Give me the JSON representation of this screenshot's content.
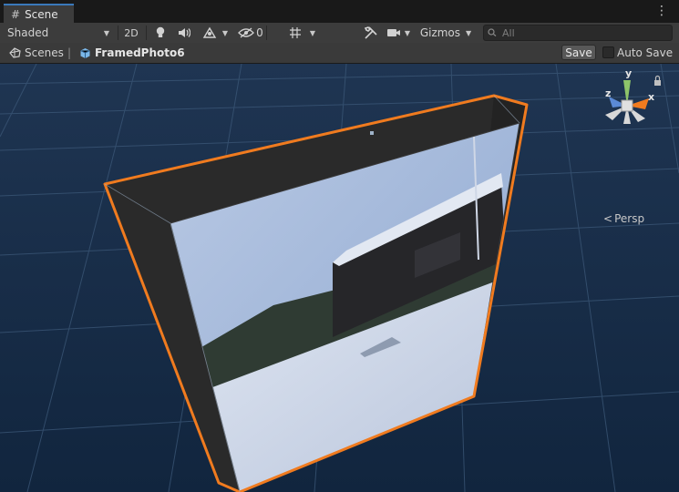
{
  "tab": {
    "icon": "grid-icon",
    "title": "Scene"
  },
  "toolbar": {
    "shading_mode": "Shaded",
    "mode_2d": "2D",
    "hidden_count": "0",
    "gizmos_label": "Gizmos",
    "search_placeholder": "All"
  },
  "breadcrumb": {
    "root": "Scenes",
    "separator": "|",
    "current": "FramedPhoto6"
  },
  "actions": {
    "save_label": "Save",
    "autosave_label": "Auto Save",
    "autosave_checked": false
  },
  "view_gizmo": {
    "y_label": "y",
    "x_label": "x",
    "z_label": "z",
    "projection_label": "Persp"
  },
  "colors": {
    "background_top": "#1f3552",
    "background_bottom": "#11253e",
    "grid": "#3c5878",
    "selection_outline": "#f07b1f",
    "frame": "#2a2a2a",
    "tab_accent": "#3a79bb"
  }
}
